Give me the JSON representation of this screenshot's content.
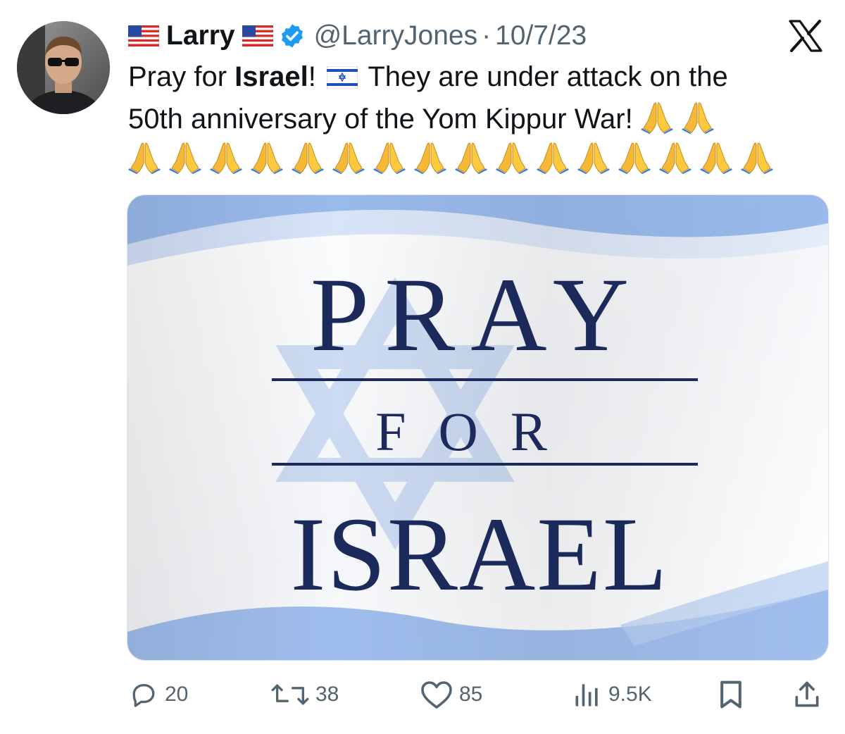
{
  "author": {
    "display_name": "Larry",
    "handle": "@LarryJones",
    "separator": "·",
    "date": "10/7/23"
  },
  "tweet": {
    "line1_pre": "Pray for ",
    "line1_bold": "Israel",
    "line1_excl": "!",
    "line1_post": " They are under attack on the",
    "line2": "50th anniversary of the Yom Kippur War!",
    "pray_emoji_count_line2": 2,
    "pray_emoji_count_line3": 16
  },
  "media": {
    "text_top": "PRAY",
    "text_mid": "FOR",
    "text_bottom": "ISRAEL"
  },
  "actions": {
    "replies": "20",
    "retweets": "38",
    "likes": "85",
    "views": "9.5K"
  },
  "colors": {
    "verified_blue": "#1d9bf0",
    "meta_gray": "#536471",
    "text_dark": "#0f1419",
    "media_text_navy": "#1b2a5a",
    "flag_blue": "#8fb3ea"
  },
  "icons": [
    "us-flag-icon",
    "verified-badge-icon",
    "israel-flag-icon",
    "x-logo-icon",
    "folded-hands-icon",
    "reply-icon",
    "retweet-icon",
    "like-icon",
    "views-icon",
    "bookmark-icon",
    "share-icon"
  ]
}
